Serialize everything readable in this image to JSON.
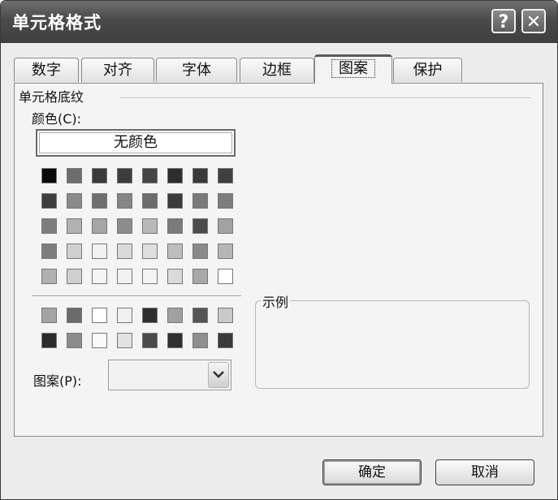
{
  "window": {
    "title": "单元格格式",
    "help_label": "?",
    "close_label": "✕"
  },
  "tabs": [
    {
      "label": "数字"
    },
    {
      "label": "对齐"
    },
    {
      "label": "字体"
    },
    {
      "label": "边框"
    },
    {
      "label": "图案",
      "active": true
    },
    {
      "label": "保护"
    }
  ],
  "shading": {
    "group_title": "单元格底纹",
    "color_label": "颜色(C):",
    "no_color_label": "无颜色"
  },
  "palette_main": [
    [
      "#0a0a0a",
      "#6e6e6e",
      "#3a3a3a",
      "#3c3c3c",
      "#454545",
      "#2e2e2e",
      "#3a3a3a",
      "#3f3f3f"
    ],
    [
      "#3e3e3e",
      "#8a8a8a",
      "#6f6f6f",
      "#858585",
      "#6c6c6c",
      "#3a3a3a",
      "#7a7a7a",
      "#7d7d7d"
    ],
    [
      "#7d7d7d",
      "#b2b2b2",
      "#a5a5a5",
      "#8c8c8c",
      "#b8b8b8",
      "#7a7a7a",
      "#4c4c4c",
      "#a2a2a2"
    ],
    [
      "#7d7d7d",
      "#d0d0d0",
      "#f2f2f2",
      "#dadada",
      "#dedede",
      "#bdbdbd",
      "#8a8a8a",
      "#b6b6b6"
    ],
    [
      "#b0b0b0",
      "#cfcfcf",
      "#f5f5f5",
      "#f2f2f2",
      "#f3f3f3",
      "#dadada",
      "#a8a8a8",
      "#ffffff"
    ]
  ],
  "palette_extra": [
    [
      "#a4a4a4",
      "#6b6b6b",
      "#ffffff",
      "#f0f0f0",
      "#2e2e2e",
      "#a0a0a0",
      "#555555",
      "#c9c9c9"
    ],
    [
      "#2a2a2a",
      "#8c8c8c",
      "#fafafa",
      "#e2e2e2",
      "#4a4a4a",
      "#303030",
      "#8f8f8f",
      "#3a3a3a"
    ]
  ],
  "pattern": {
    "label": "图案(P):",
    "value": "",
    "arrow_icon": "chevron-down-icon"
  },
  "sample": {
    "title": "示例"
  },
  "buttons": {
    "ok_label": "确定",
    "cancel_label": "取消"
  }
}
